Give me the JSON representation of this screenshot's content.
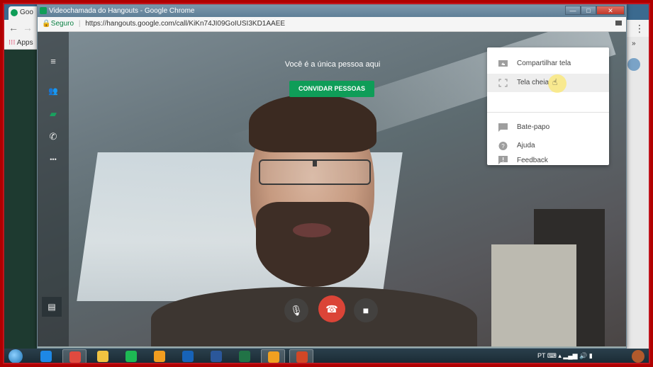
{
  "background_window": {
    "tab_label": "Goo",
    "apps_label": "Apps"
  },
  "popup": {
    "title": "Videochamada do Hangouts - Google Chrome",
    "window_controls": {
      "minimize": "—",
      "maximize": "□",
      "close": "✕"
    },
    "address": {
      "secure_label": "Seguro",
      "separator": "|",
      "url": "https://hangouts.google.com/call/KiKn74JI09GoIUSI3KD1AAEE"
    }
  },
  "call": {
    "alone_message": "Você é a única pessoa aqui",
    "invite_button": "CONVIDAR PESSOAS"
  },
  "sidebar": {
    "items": [
      {
        "icon": "menu-icon",
        "glyph": "≡"
      },
      {
        "icon": "people-icon",
        "glyph": "👥"
      },
      {
        "icon": "chat-icon",
        "glyph": "▰"
      },
      {
        "icon": "phone-icon",
        "glyph": "✆"
      },
      {
        "icon": "more-icon",
        "glyph": "•••"
      }
    ]
  },
  "menu": {
    "items": [
      {
        "label": "Compartilhar tela",
        "icon": "screen-share-icon"
      },
      {
        "label": "Tela cheia",
        "icon": "fullscreen-icon"
      },
      {
        "label": "Bate-papo",
        "icon": "chat-bubble-icon"
      },
      {
        "label": "Ajuda",
        "icon": "help-icon"
      },
      {
        "label": "Feedback",
        "icon": "feedback-icon"
      }
    ],
    "hovered": "Tela cheia"
  },
  "controls": {
    "mic": "🎙",
    "hangup": "☎",
    "camera": "■",
    "chat": "▤"
  },
  "taskbar": {
    "apps": [
      {
        "name": "internet-explorer",
        "color": "#1e88e5"
      },
      {
        "name": "chrome",
        "color": "#e04a3f"
      },
      {
        "name": "file-explorer",
        "color": "#f0c341"
      },
      {
        "name": "spotify",
        "color": "#1db954"
      },
      {
        "name": "media-player",
        "color": "#f29d1f"
      },
      {
        "name": "outlook",
        "color": "#1763b8"
      },
      {
        "name": "word",
        "color": "#2b579a"
      },
      {
        "name": "excel",
        "color": "#217346"
      },
      {
        "name": "hangouts-call",
        "color": "#f0a020"
      },
      {
        "name": "powerpoint",
        "color": "#d24726"
      }
    ],
    "tray_language": "PT"
  },
  "colors": {
    "accent_green": "#0f9d58",
    "hangup_red": "#db4437",
    "frame_red": "#c0141c"
  }
}
